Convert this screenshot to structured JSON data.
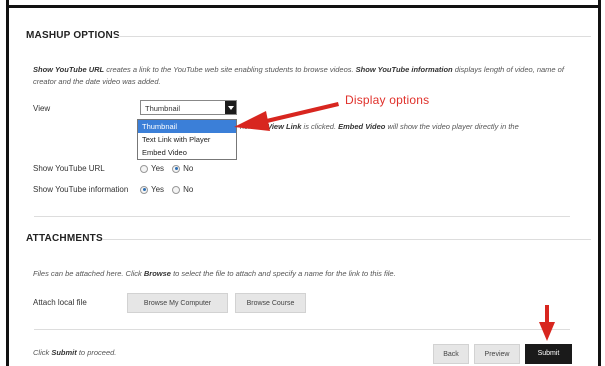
{
  "mashup": {
    "heading": "MASHUP OPTIONS",
    "description_parts": [
      {
        "b": true,
        "t": "Show YouTube URL"
      },
      {
        "b": false,
        "t": " creates a link to the YouTube web site enabling students to browse videos. "
      },
      {
        "b": true,
        "t": "Show YouTube information"
      },
      {
        "b": false,
        "t": " displays length of video, name of creator and the date video was added."
      }
    ],
    "view_label": "View",
    "view_selected": "Thumbnail",
    "view_options": [
      "Thumbnail",
      "Text Link with Player",
      "Embed Video"
    ],
    "view_note_1": "nen the ",
    "view_note_link": "View Link",
    "view_note_2": " is clicked. ",
    "view_note_embed": "Embed Video",
    "view_note_3": " will show the video player directly in the",
    "show_url_label": "Show YouTube URL",
    "show_info_label": "Show YouTube information",
    "yes": "Yes",
    "no": "No",
    "show_url_value": "No",
    "show_info_value": "Yes"
  },
  "attachments": {
    "heading": "ATTACHMENTS",
    "description_parts": [
      {
        "b": false,
        "t": "Files can be attached here. Click "
      },
      {
        "b": true,
        "t": "Browse"
      },
      {
        "b": false,
        "t": " to select the file to attach and specify a name for the link to this file."
      }
    ],
    "attach_label": "Attach local file",
    "browse_computer": "Browse My Computer",
    "browse_course": "Browse Course"
  },
  "footer": {
    "instruction_pre": "Click ",
    "instruction_bold": "Submit",
    "instruction_post": " to proceed.",
    "back": "Back",
    "preview": "Preview",
    "submit": "Submit"
  },
  "annotation": {
    "callout_text": "Display options",
    "arrow_color": "#e0312b"
  }
}
